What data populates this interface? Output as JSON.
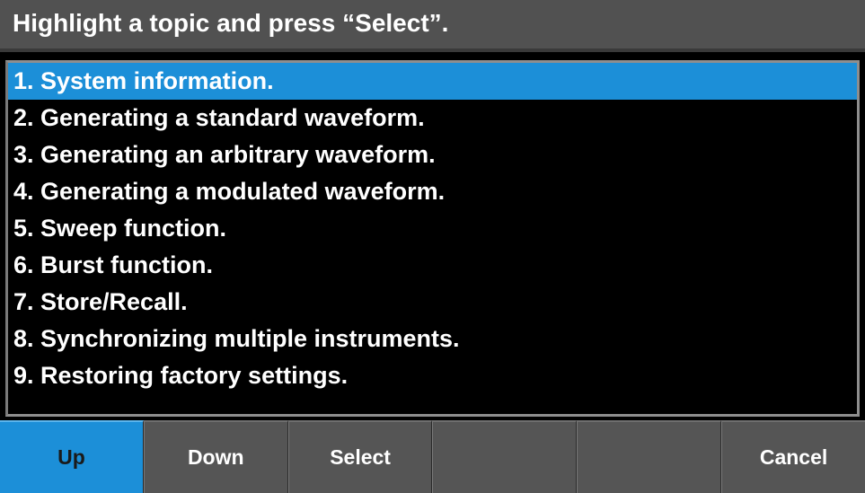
{
  "header": {
    "title": "Highlight a topic and press “Select”."
  },
  "topics": [
    {
      "label": "1. System information.",
      "selected": true
    },
    {
      "label": "2. Generating a standard waveform.",
      "selected": false
    },
    {
      "label": "3. Generating an arbitrary waveform.",
      "selected": false
    },
    {
      "label": "4. Generating a modulated waveform.",
      "selected": false
    },
    {
      "label": "5. Sweep function.",
      "selected": false
    },
    {
      "label": "6. Burst function.",
      "selected": false
    },
    {
      "label": "7. Store/Recall.",
      "selected": false
    },
    {
      "label": "8. Synchronizing multiple instruments.",
      "selected": false
    },
    {
      "label": "9. Restoring factory settings.",
      "selected": false
    }
  ],
  "softkeys": [
    {
      "label": "Up",
      "active": true
    },
    {
      "label": "Down",
      "active": false
    },
    {
      "label": "Select",
      "active": false
    },
    {
      "label": "",
      "active": false
    },
    {
      "label": "",
      "active": false
    },
    {
      "label": "Cancel",
      "active": false
    }
  ],
  "colors": {
    "selection": "#1c8fd8",
    "header_bg": "#515151",
    "softkey_bg": "#555555",
    "list_bg": "#000000"
  }
}
